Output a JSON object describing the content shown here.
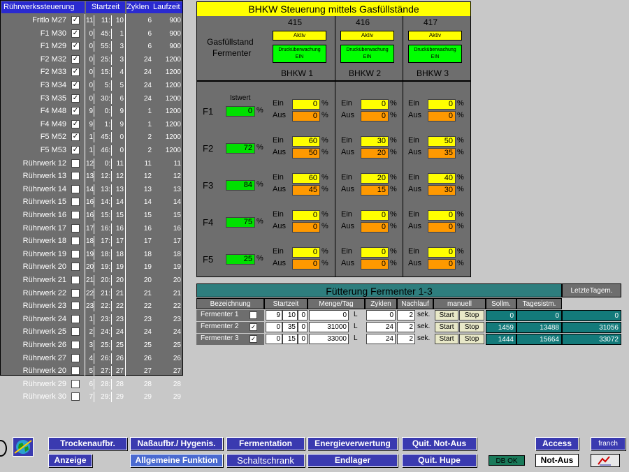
{
  "ruehrwerk": {
    "header_name": "Rührwerkssteuerung",
    "header_start": "Startzeit",
    "header_zyklen": "Zyklen",
    "header_laufzeit": "Laufzeit",
    "rows": [
      {
        "name": "Fritlo M27",
        "checked": true,
        "a": "11",
        "b": "11:",
        "c": "10",
        "z": "6",
        "l": "900"
      },
      {
        "name": "F1 M30",
        "checked": true,
        "a": "0",
        "b": "45:",
        "c": "1",
        "z": "6",
        "l": "900"
      },
      {
        "name": "F1 M29",
        "checked": true,
        "a": "0",
        "b": "55:",
        "c": "3",
        "z": "6",
        "l": "900"
      },
      {
        "name": "F2 M32",
        "checked": true,
        "a": "0",
        "b": "25:",
        "c": "3",
        "z": "24",
        "l": "1200"
      },
      {
        "name": "F2 M33",
        "checked": true,
        "a": "0",
        "b": "15:",
        "c": "4",
        "z": "24",
        "l": "1200"
      },
      {
        "name": "F3 M34",
        "checked": true,
        "a": "0",
        "b": "5:",
        "c": "5",
        "z": "24",
        "l": "1200"
      },
      {
        "name": "F3 M35",
        "checked": true,
        "a": "0",
        "b": "30:",
        "c": "6",
        "z": "24",
        "l": "1200"
      },
      {
        "name": "F4 M48",
        "checked": true,
        "a": "9",
        "b": "0:",
        "c": "9",
        "z": "1",
        "l": "1200"
      },
      {
        "name": "F4 M49",
        "checked": true,
        "a": "9",
        "b": "1:",
        "c": "9",
        "z": "1",
        "l": "1200"
      },
      {
        "name": "F5 M52",
        "checked": true,
        "a": "1",
        "b": "45:",
        "c": "0",
        "z": "2",
        "l": "1200"
      },
      {
        "name": "F5 M53",
        "checked": true,
        "a": "1",
        "b": "46:",
        "c": "0",
        "z": "2",
        "l": "1200"
      },
      {
        "name": "Rührwerk 12",
        "checked": false,
        "a": "12",
        "b": "0:",
        "c": "11",
        "z": "11",
        "l": "11"
      },
      {
        "name": "Rührwerk 13",
        "checked": false,
        "a": "13",
        "b": "12:",
        "c": "12",
        "z": "12",
        "l": "12"
      },
      {
        "name": "Rührwerk 14",
        "checked": false,
        "a": "14",
        "b": "13:",
        "c": "13",
        "z": "13",
        "l": "13"
      },
      {
        "name": "Rührwerk 15",
        "checked": false,
        "a": "16",
        "b": "14:",
        "c": "14",
        "z": "14",
        "l": "14"
      },
      {
        "name": "Rührwerk 16",
        "checked": false,
        "a": "16",
        "b": "15:",
        "c": "15",
        "z": "15",
        "l": "15"
      },
      {
        "name": "Rührwerk 17",
        "checked": false,
        "a": "17",
        "b": "16:",
        "c": "16",
        "z": "16",
        "l": "16"
      },
      {
        "name": "Rührwerk 18",
        "checked": false,
        "a": "18",
        "b": "17:",
        "c": "17",
        "z": "17",
        "l": "17"
      },
      {
        "name": "Rührwerk 19",
        "checked": false,
        "a": "19",
        "b": "18:",
        "c": "18",
        "z": "18",
        "l": "18"
      },
      {
        "name": "Rührwerk 20",
        "checked": false,
        "a": "20",
        "b": "19:",
        "c": "19",
        "z": "19",
        "l": "19"
      },
      {
        "name": "Rührwerk 21",
        "checked": false,
        "a": "21",
        "b": "20:",
        "c": "20",
        "z": "20",
        "l": "20"
      },
      {
        "name": "Rührwerk 22",
        "checked": false,
        "a": "22",
        "b": "21:",
        "c": "21",
        "z": "21",
        "l": "21"
      },
      {
        "name": "Rührwerk 23",
        "checked": false,
        "a": "23",
        "b": "22:",
        "c": "22",
        "z": "22",
        "l": "22"
      },
      {
        "name": "Rührwerk 24",
        "checked": false,
        "a": "1",
        "b": "23:",
        "c": "23",
        "z": "23",
        "l": "23"
      },
      {
        "name": "Rührwerk 25",
        "checked": false,
        "a": "2",
        "b": "24:",
        "c": "24",
        "z": "24",
        "l": "24"
      },
      {
        "name": "Rührwerk 26",
        "checked": false,
        "a": "3",
        "b": "25:",
        "c": "25",
        "z": "25",
        "l": "25"
      },
      {
        "name": "Rührwerk 27",
        "checked": false,
        "a": "4",
        "b": "26:",
        "c": "26",
        "z": "26",
        "l": "26"
      },
      {
        "name": "Rührwerk 20",
        "checked": false,
        "a": "5",
        "b": "27:",
        "c": "27",
        "z": "27",
        "l": "27"
      },
      {
        "name": "Rührwerk 29",
        "checked": false,
        "a": "6",
        "b": "28:",
        "c": "28",
        "z": "28",
        "l": "28"
      },
      {
        "name": "Rührwerk 30",
        "checked": false,
        "a": "7",
        "b": "29:",
        "c": "29",
        "z": "29",
        "l": "29"
      }
    ]
  },
  "bhkw": {
    "title": "BHKW Steuerung mittels Gasfüllstände",
    "gasfuellstand_label_1": "Gasfüllstand",
    "gasfuellstand_label_2": "Fermenter",
    "istwert_label": "Istwert",
    "units": [
      {
        "number": "415",
        "aktiv": "Aktiv",
        "druck_1": "Drucküberwachung",
        "druck_2": "EIN",
        "name": "BHKW 1"
      },
      {
        "number": "416",
        "aktiv": "Aktiv",
        "druck_1": "Drucküberwachung",
        "druck_2": "EIN",
        "name": "BHKW 2"
      },
      {
        "number": "417",
        "aktiv": "Aktiv",
        "druck_1": "Drucküberwachung",
        "druck_2": "EIN",
        "name": "BHKW 3"
      }
    ],
    "ein_label": "Ein",
    "aus_label": "Aus",
    "pct": "%",
    "fermenters": [
      {
        "label": "F1",
        "istwert": "0",
        "vals": [
          [
            "0",
            "0"
          ],
          [
            "0",
            "0"
          ],
          [
            "0",
            "0"
          ]
        ]
      },
      {
        "label": "F2",
        "istwert": "72",
        "vals": [
          [
            "60",
            "50"
          ],
          [
            "30",
            "20"
          ],
          [
            "50",
            "35"
          ]
        ]
      },
      {
        "label": "F3",
        "istwert": "84",
        "vals": [
          [
            "60",
            "45"
          ],
          [
            "20",
            "15"
          ],
          [
            "40",
            "30"
          ]
        ]
      },
      {
        "label": "F4",
        "istwert": "75",
        "vals": [
          [
            "0",
            "0"
          ],
          [
            "0",
            "0"
          ],
          [
            "0",
            "0"
          ]
        ]
      },
      {
        "label": "F5",
        "istwert": "25",
        "vals": [
          [
            "0",
            "0"
          ],
          [
            "0",
            "0"
          ],
          [
            "0",
            "0"
          ]
        ]
      }
    ]
  },
  "fuetterung": {
    "title": "Fütterung Fermenter 1-3",
    "letzte": "LetzteTagem.",
    "headers": {
      "bez": "Bezeichnung",
      "start": "Startzeit",
      "menge": "Menge/Tag",
      "zyklen": "Zyklen",
      "nachlauf": "Nachlauf",
      "manuell": "manuell",
      "soll": "Sollm.",
      "tages": "Tagesistm."
    },
    "rows": [
      {
        "name": "Fermenter 1",
        "checked": false,
        "h": "9",
        "m": "10",
        "s": "0",
        "menge": "0",
        "unit": "L",
        "zyklen": "0",
        "nach": "2",
        "sek": "sek.",
        "start": "Start",
        "stop": "Stop",
        "soll": "0",
        "tages": "0",
        "letzte": "0"
      },
      {
        "name": "Fermenter 2",
        "checked": true,
        "h": "0",
        "m": "35",
        "s": "0",
        "menge": "31000",
        "unit": "L",
        "zyklen": "24",
        "nach": "2",
        "sek": "sek.",
        "start": "Start",
        "stop": "Stop",
        "soll": "1459",
        "tages": "13488",
        "letzte": "31056"
      },
      {
        "name": "Fermenter 3",
        "checked": true,
        "h": "0",
        "m": "15",
        "s": "0",
        "menge": "33000",
        "unit": "L",
        "zyklen": "24",
        "nach": "2",
        "sek": "sek.",
        "start": "Start",
        "stop": "Stop",
        "soll": "1444",
        "tages": "15664",
        "letzte": "33072"
      }
    ]
  },
  "nav": {
    "trocken": "Trockenaufbr.",
    "nass": "Naßaufbr./ Hygenis.",
    "fermentation": "Fermentation",
    "energie": "Energieverwertung",
    "quit_notaus": "Quit. Not-Aus",
    "access": "Access",
    "user": "franch",
    "anzeige": "Anzeige",
    "allgemein": "Allgemeine Funktion",
    "schaltschrank": "Schaltschrank",
    "endlager": "Endlager",
    "quit_hupe": "Quit. Hupe",
    "db_ok": "DB OK",
    "notaus": "Not-Aus"
  }
}
